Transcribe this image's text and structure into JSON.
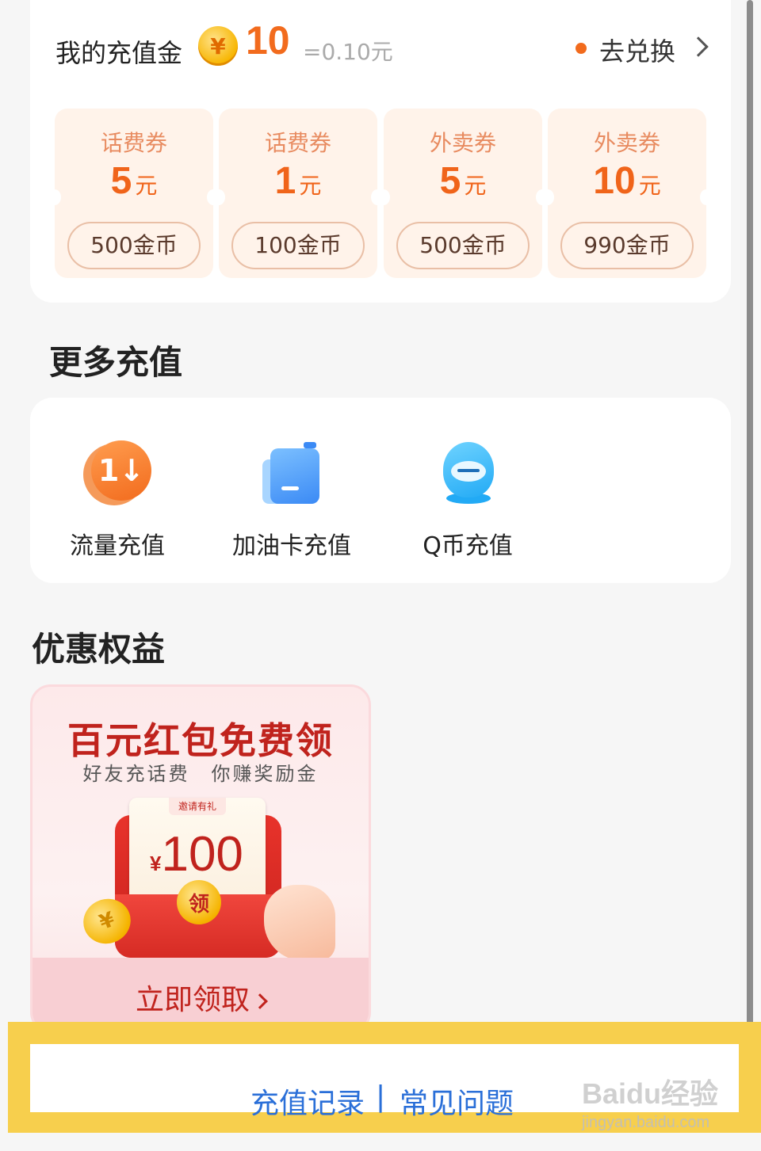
{
  "balance": {
    "title": "我的充值金",
    "coin_symbol": "¥",
    "value": "10",
    "equivalent": "=0.10元",
    "exchange_label": "去兑换"
  },
  "coupons": [
    {
      "type": "话费券",
      "amount": "5",
      "unit": "元",
      "price": "500金币"
    },
    {
      "type": "话费券",
      "amount": "1",
      "unit": "元",
      "price": "100金币"
    },
    {
      "type": "外卖券",
      "amount": "5",
      "unit": "元",
      "price": "500金币"
    },
    {
      "type": "外卖券",
      "amount": "10",
      "unit": "元",
      "price": "990金币"
    }
  ],
  "more_recharge": {
    "title": "更多充值",
    "items": [
      {
        "label": "流量充值",
        "icon": "data-traffic-icon",
        "glyph": "1↓"
      },
      {
        "label": "加油卡充值",
        "icon": "fuel-card-icon"
      },
      {
        "label": "Q币充值",
        "icon": "qq-coin-icon"
      }
    ]
  },
  "benefits": {
    "title": "优惠权益",
    "promo": {
      "headline": "百元红包免费领",
      "subline": "好友充话费　你赚奖励金",
      "tag": "邀请有礼",
      "currency": "¥",
      "amount": "100",
      "seal": "领",
      "coin_glyph": "¥",
      "button": "立即领取"
    }
  },
  "footer": {
    "records": "充值记录",
    "separator": "|",
    "faq": "常见问题",
    "highlight_color": "#f7cf4d"
  },
  "watermark": {
    "brand": "Baidu经验",
    "url": "jingyan.baidu.com"
  }
}
